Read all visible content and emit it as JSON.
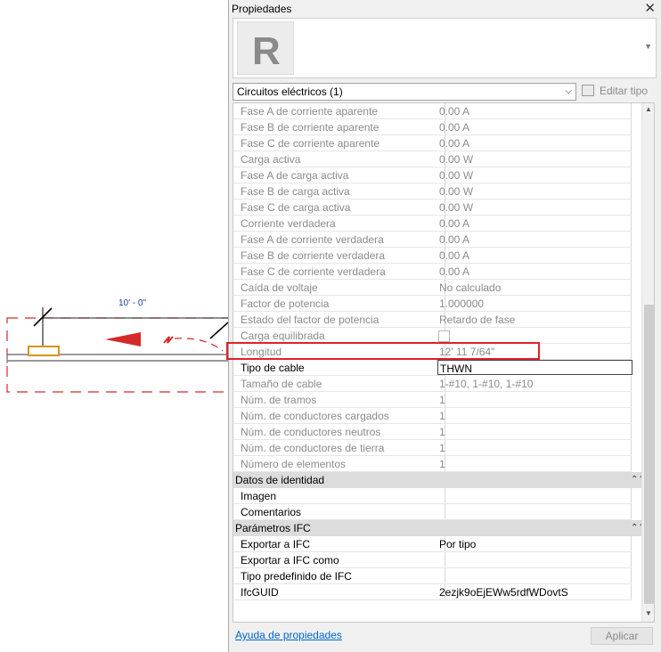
{
  "canvas": {
    "dimension_label": "10' - 0\""
  },
  "palette": {
    "title": "Propiedades",
    "close_glyph": "✕",
    "type_logo_text": "R",
    "filter_value": "Circuitos eléctricos (1)",
    "edit_type_label": "Editar tipo",
    "help_link": "Ayuda de propiedades",
    "apply_label": "Aplicar"
  },
  "rows": [
    {
      "label": "Fase A de corriente aparente",
      "value": "0.00 A"
    },
    {
      "label": "Fase B de corriente aparente",
      "value": "0.00 A"
    },
    {
      "label": "Fase C de corriente aparente",
      "value": "0.00 A"
    },
    {
      "label": "Carga activa",
      "value": "0.00 W"
    },
    {
      "label": "Fase A de carga activa",
      "value": "0.00 W"
    },
    {
      "label": "Fase B de carga activa",
      "value": "0.00 W"
    },
    {
      "label": "Fase C de carga activa",
      "value": "0.00 W"
    },
    {
      "label": "Corriente verdadera",
      "value": "0.00 A"
    },
    {
      "label": "Fase A de corriente verdadera",
      "value": "0.00 A"
    },
    {
      "label": "Fase B de corriente verdadera",
      "value": "0.00 A"
    },
    {
      "label": "Fase C de corriente verdadera",
      "value": "0.00 A"
    },
    {
      "label": "Caída de voltaje",
      "value": "No calculado"
    },
    {
      "label": "Factor de potencia",
      "value": "1.000000"
    },
    {
      "label": "Estado del factor de potencia",
      "value": "Retardo de fase"
    },
    {
      "label": "Carga equilibrada",
      "value": ""
    },
    {
      "label": "Longitud",
      "value": "12'  11 7/64\""
    },
    {
      "label": "Tipo de cable",
      "value": "THWN"
    },
    {
      "label": "Tamaño de cable",
      "value": "1-#10, 1-#10, 1-#10"
    },
    {
      "label": "Núm. de tramos",
      "value": "1"
    },
    {
      "label": "Núm. de conductores cargados",
      "value": "1"
    },
    {
      "label": "Núm. de conductores neutros",
      "value": "1"
    },
    {
      "label": "Núm. de conductores de tierra",
      "value": "1"
    },
    {
      "label": "Número de elementos",
      "value": "1"
    }
  ],
  "groups": {
    "identity": {
      "title": "Datos de identidad",
      "rows": [
        {
          "label": "Imagen",
          "value": ""
        },
        {
          "label": "Comentarios",
          "value": ""
        }
      ]
    },
    "ifc": {
      "title": "Parámetros IFC",
      "rows": [
        {
          "label": "Exportar a IFC",
          "value": "Por tipo"
        },
        {
          "label": "Exportar a IFC como",
          "value": ""
        },
        {
          "label": "Tipo predefinido de IFC",
          "value": ""
        },
        {
          "label": "IfcGUID",
          "value": "2ezjk9oEjEWw5rdfWDovtS"
        }
      ]
    }
  },
  "colors": {
    "highlight": "#e0202a",
    "wire": "#d42a2a",
    "device": "#d9931c",
    "dimension_text": "#1f3f9f",
    "link": "#0066cc"
  }
}
